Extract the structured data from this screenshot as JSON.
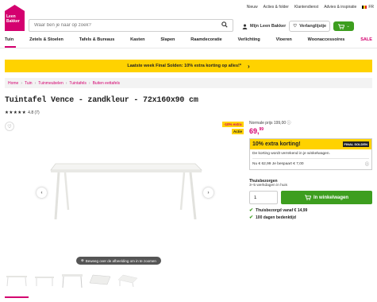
{
  "util": {
    "links": [
      "Nieuw",
      "Acties & folder",
      "Klantendienst",
      "Advies & inspiratie"
    ],
    "lang": "FR"
  },
  "logo": {
    "text": "Leen Bakker"
  },
  "search": {
    "placeholder": "Waar ben je naar op zoek?"
  },
  "header": {
    "account": "Mijn Leen Bakker",
    "wishlist": "Verlanglijstje"
  },
  "nav": {
    "items": [
      "Tuin",
      "Zetels & Stoelen",
      "Tafels & Bureaus",
      "Kasten",
      "Slapen",
      "Raamdecoratie",
      "Verlichting",
      "Vloeren",
      "Woonaccessoires"
    ],
    "sale": "SALE"
  },
  "banner": {
    "text": "Laatste week Final Solden: 10% extra korting op alles!*",
    "arrow": "›"
  },
  "breadcrumb": [
    "Home",
    "Tuin",
    "Tuinmeubelen",
    "Tuintafels",
    "Buiten eettafels"
  ],
  "product": {
    "title": "Tuintafel Vence - zandkleur - 72x160x90 cm",
    "stars": "★★★★★",
    "rating": "4.8 (7)"
  },
  "gallery": {
    "badge_discount": "-10% extra",
    "badge_actie": "Actie",
    "zoom_hint": "Beweeg over de afbeelding om in te zoomen"
  },
  "pricing": {
    "normal_label": "Normale prijs 199,00",
    "price_main": "69,",
    "price_cents": "99"
  },
  "promo": {
    "title": "10% extra korting!",
    "badge": "FINAL SOLDEN",
    "desc": "De korting wordt verrekend in je winkelwagen.",
    "line": "Nu € 62,99  Je bespaart € 7,00"
  },
  "delivery": {
    "title": "Thuisbezorgen",
    "sub": "3–5 werkdagen in huis"
  },
  "buy": {
    "qty": "1",
    "button": "In winkelwagen"
  },
  "usps": [
    "Thuisbezorgd vanaf € 14,99",
    "100 dagen bedenktijd"
  ],
  "colors": {
    "brand": "#d4006f",
    "yellow": "#ffd200",
    "green": "#3d9e1f"
  }
}
